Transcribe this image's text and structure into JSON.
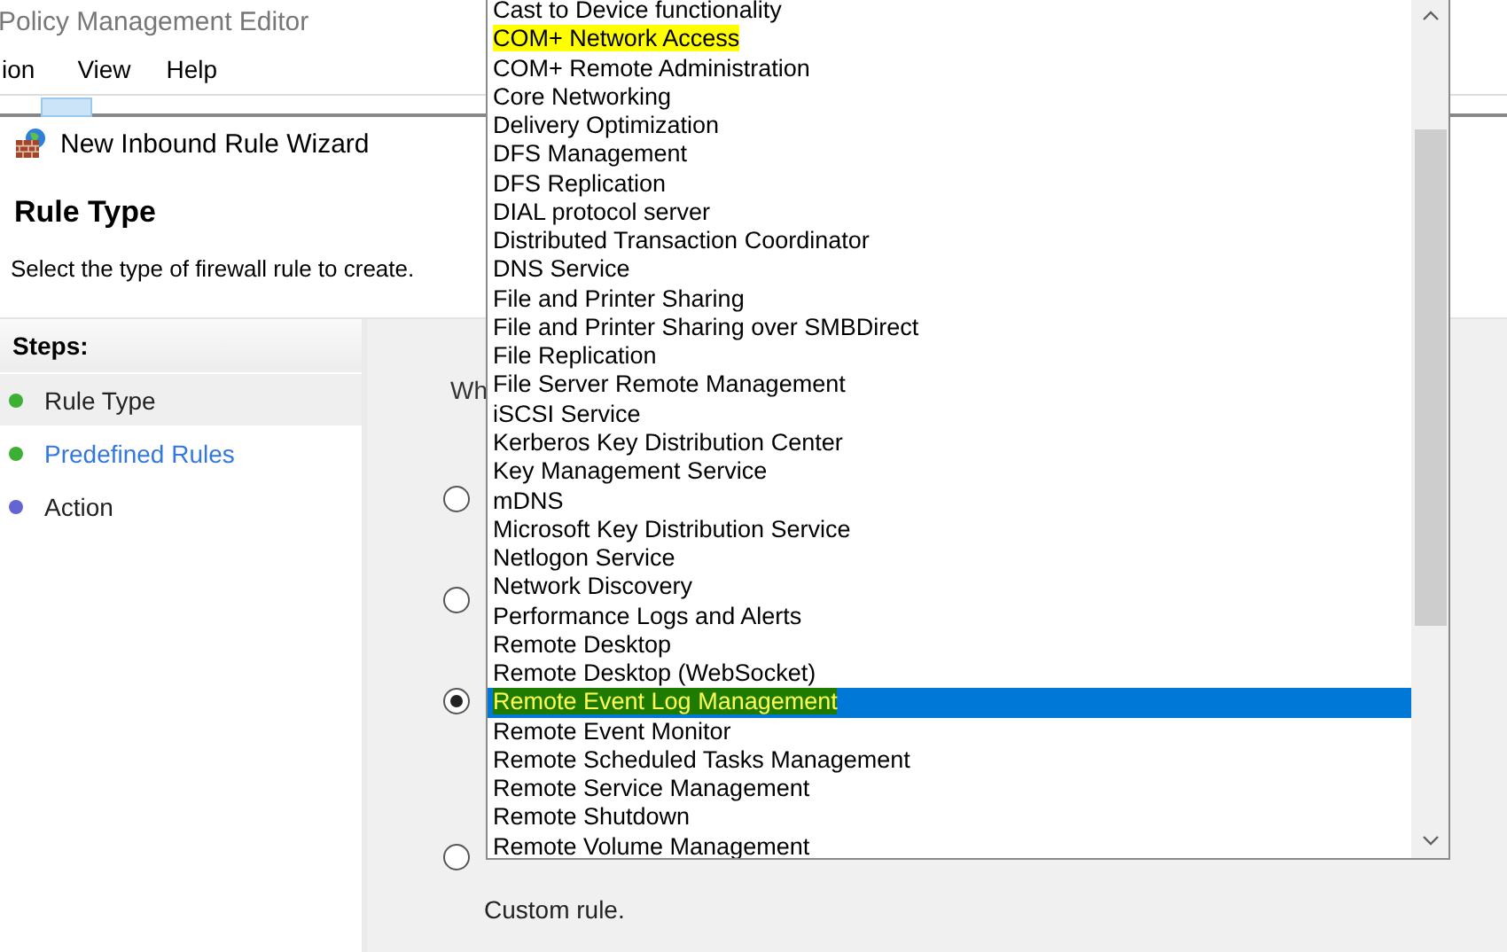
{
  "window": {
    "title": "Policy Management Editor"
  },
  "menu": [
    "ion",
    "View",
    "Help"
  ],
  "wizard": {
    "title": "New Inbound Rule Wizard",
    "heading": "Rule Type",
    "description": "Select the type of firewall rule to create."
  },
  "steps": {
    "title": "Steps:",
    "items": [
      {
        "label": "Rule Type",
        "selected": true,
        "hovered": false,
        "color": "#3cb034"
      },
      {
        "label": "Predefined Rules",
        "selected": false,
        "hovered": true,
        "color": "#3cb034"
      },
      {
        "label": "Action",
        "selected": false,
        "hovered": false,
        "color": "#6464d2"
      }
    ]
  },
  "question": "Wh",
  "options": [
    {
      "selected": false
    },
    {
      "selected": false
    },
    {
      "selected": true
    },
    {
      "selected": false,
      "description": "Custom rule."
    }
  ],
  "dropdown_list": {
    "items": [
      {
        "label": "Cast to Device functionality",
        "selected": false,
        "highlighted": false
      },
      {
        "label": "COM+ Network Access",
        "selected": false,
        "highlighted": true
      },
      {
        "label": "COM+ Remote Administration",
        "selected": false,
        "highlighted": false
      },
      {
        "label": "Core Networking",
        "selected": false,
        "highlighted": false
      },
      {
        "label": "Delivery Optimization",
        "selected": false,
        "highlighted": false
      },
      {
        "label": "DFS Management",
        "selected": false,
        "highlighted": false
      },
      {
        "label": "DFS Replication",
        "selected": false,
        "highlighted": false
      },
      {
        "label": "DIAL protocol server",
        "selected": false,
        "highlighted": false
      },
      {
        "label": "Distributed Transaction Coordinator",
        "selected": false,
        "highlighted": false
      },
      {
        "label": "DNS Service",
        "selected": false,
        "highlighted": false
      },
      {
        "label": "File and Printer Sharing",
        "selected": false,
        "highlighted": false
      },
      {
        "label": "File and Printer Sharing over SMBDirect",
        "selected": false,
        "highlighted": false
      },
      {
        "label": "File Replication",
        "selected": false,
        "highlighted": false
      },
      {
        "label": "File Server Remote Management",
        "selected": false,
        "highlighted": false
      },
      {
        "label": "iSCSI Service",
        "selected": false,
        "highlighted": false
      },
      {
        "label": "Kerberos Key Distribution Center",
        "selected": false,
        "highlighted": false
      },
      {
        "label": "Key Management Service",
        "selected": false,
        "highlighted": false
      },
      {
        "label": "mDNS",
        "selected": false,
        "highlighted": false
      },
      {
        "label": "Microsoft Key Distribution Service",
        "selected": false,
        "highlighted": false
      },
      {
        "label": "Netlogon Service",
        "selected": false,
        "highlighted": false
      },
      {
        "label": "Network Discovery",
        "selected": false,
        "highlighted": false
      },
      {
        "label": "Performance Logs and Alerts",
        "selected": false,
        "highlighted": false
      },
      {
        "label": "Remote Desktop",
        "selected": false,
        "highlighted": false
      },
      {
        "label": "Remote Desktop (WebSocket)",
        "selected": false,
        "highlighted": false
      },
      {
        "label": "Remote Event Log Management",
        "selected": true,
        "highlighted": true
      },
      {
        "label": "Remote Event Monitor",
        "selected": false,
        "highlighted": false
      },
      {
        "label": "Remote Scheduled Tasks Management",
        "selected": false,
        "highlighted": false
      },
      {
        "label": "Remote Service Management",
        "selected": false,
        "highlighted": false
      },
      {
        "label": "Remote Shutdown",
        "selected": false,
        "highlighted": false
      },
      {
        "label": "Remote Volume Management",
        "selected": false,
        "highlighted": false
      }
    ]
  }
}
